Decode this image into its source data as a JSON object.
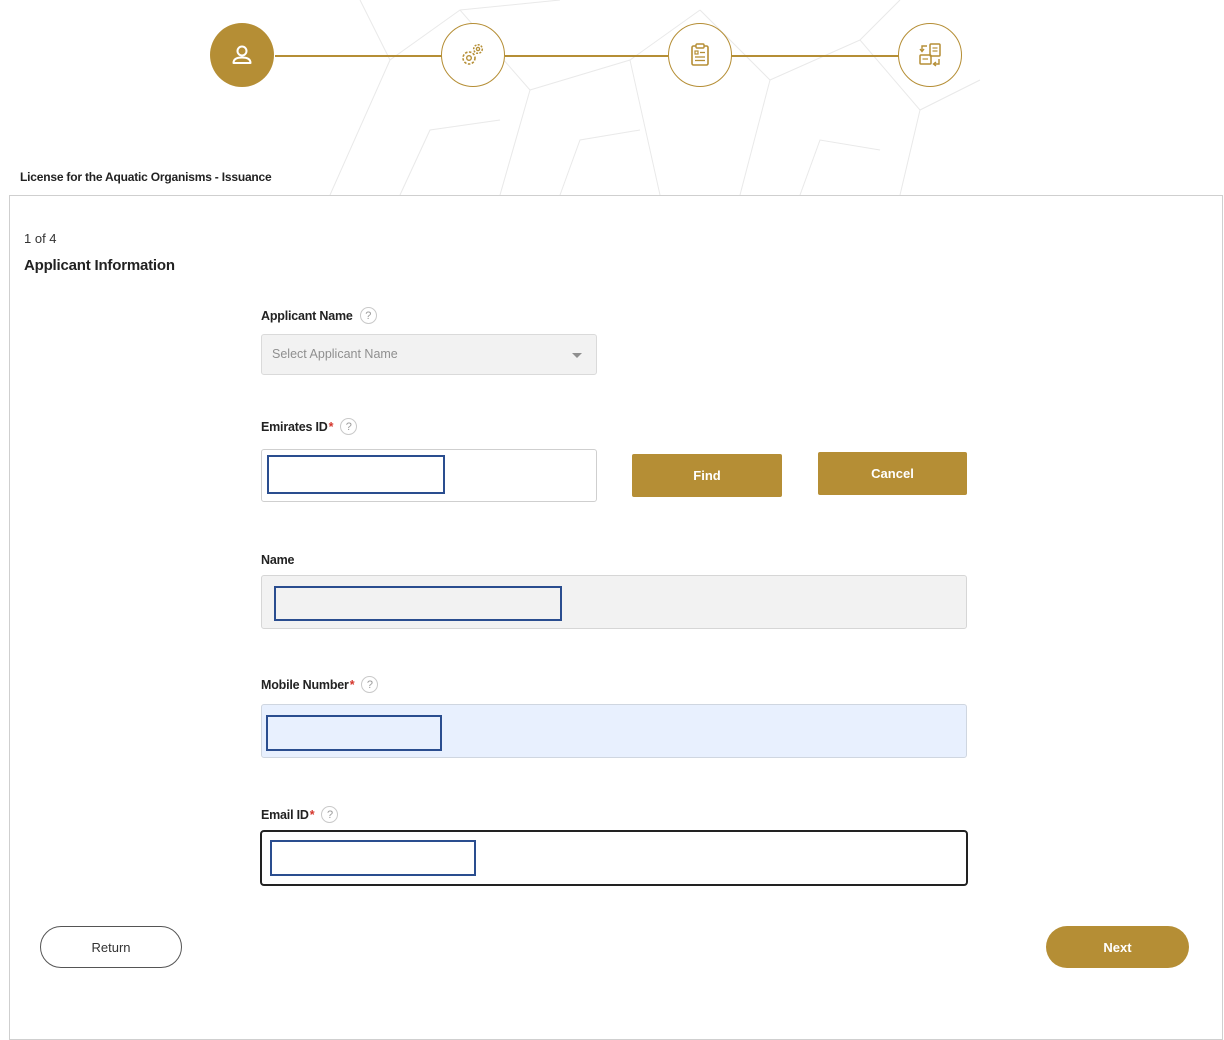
{
  "stepper": {
    "steps": [
      {
        "icon": "user-icon",
        "state": "active"
      },
      {
        "icon": "gears-icon",
        "state": "todo"
      },
      {
        "icon": "clipboard-icon",
        "state": "todo"
      },
      {
        "icon": "document-exchange-icon",
        "state": "todo"
      }
    ]
  },
  "page": {
    "service_title": "License for the Aquatic Organisms - Issuance",
    "step_count": "1 of 4",
    "section_title": "Applicant Information"
  },
  "form": {
    "applicant_name": {
      "label": "Applicant Name",
      "help": "?",
      "placeholder": "Select Applicant Name"
    },
    "emirates_id": {
      "label": "Emirates ID",
      "required_mark": "*",
      "help": "?"
    },
    "name": {
      "label": "Name"
    },
    "mobile_number": {
      "label": "Mobile Number",
      "required_mark": "*",
      "help": "?"
    },
    "email_id": {
      "label": "Email ID",
      "required_mark": "*",
      "help": "?"
    }
  },
  "buttons": {
    "find": "Find",
    "cancel": "Cancel",
    "return": "Return",
    "next": "Next"
  },
  "colors": {
    "accent": "#b58e35",
    "required": "#d4352b",
    "mask_border": "#2a4d8f",
    "mobile_field_bg": "#e8f0fe"
  }
}
